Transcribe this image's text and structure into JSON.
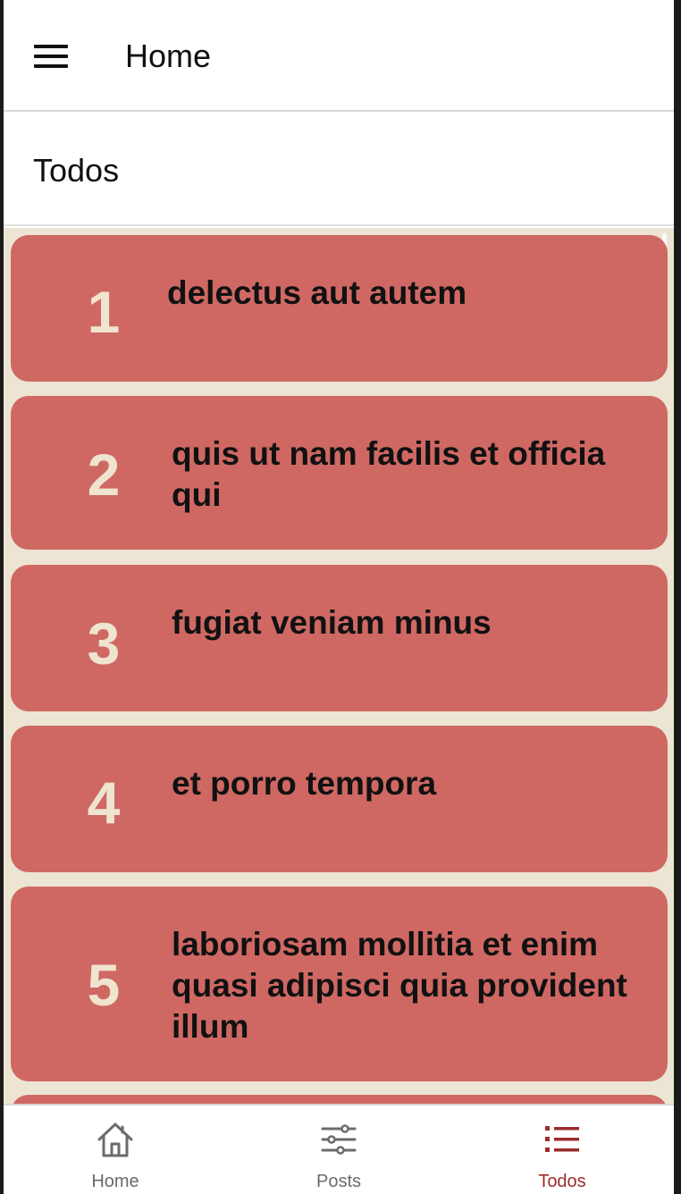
{
  "header": {
    "title": "Home"
  },
  "screen": {
    "title": "Todos"
  },
  "todos": [
    {
      "number": "1",
      "title": "delectus aut autem"
    },
    {
      "number": "2",
      "title": "quis ut nam facilis et officia qui"
    },
    {
      "number": "3",
      "title": "fugiat veniam minus"
    },
    {
      "number": "4",
      "title": "et porro tempora"
    },
    {
      "number": "5",
      "title": "laboriosam mollitia et enim quasi adipisci quia provident illum"
    }
  ],
  "tabs": [
    {
      "label": "Home",
      "icon": "home-icon",
      "active": false
    },
    {
      "label": "Posts",
      "icon": "sliders-icon",
      "active": false
    },
    {
      "label": "Todos",
      "icon": "list-icon",
      "active": true
    }
  ],
  "colors": {
    "card": "#cf6863",
    "list_background": "#ece5d3",
    "card_number": "#efe4d0",
    "active_tab": "#9b2c2c",
    "inactive_tab": "#6b6b6b"
  }
}
